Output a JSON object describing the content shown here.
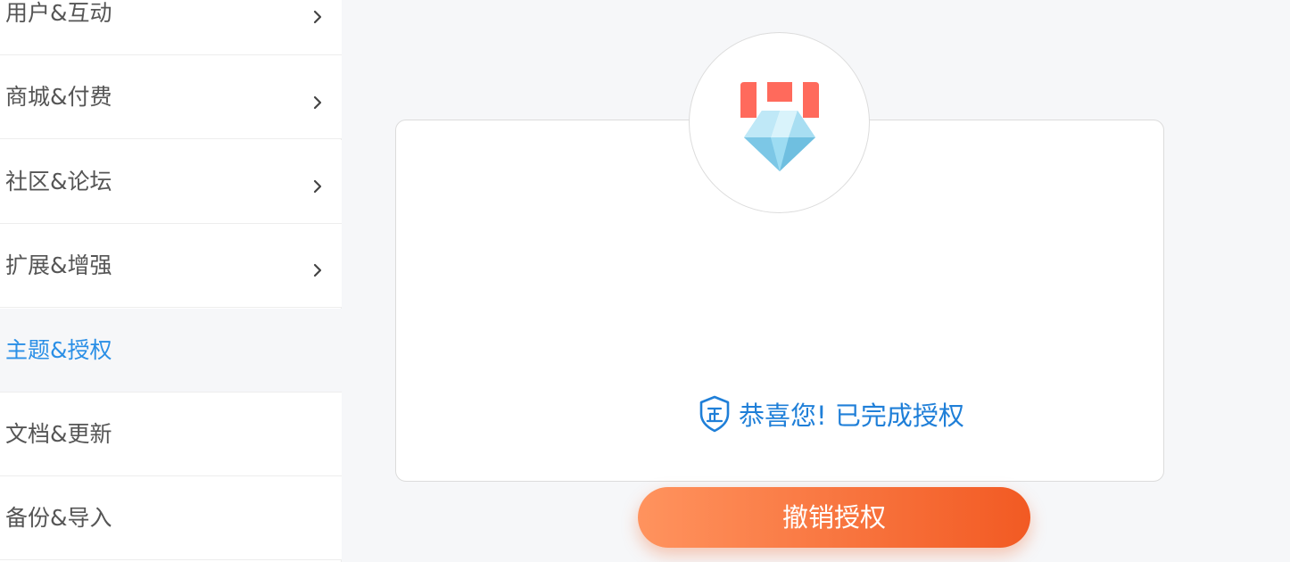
{
  "sidebar": {
    "items": [
      {
        "label": "用户&互动",
        "has_arrow": true,
        "active": false
      },
      {
        "label": "商城&付费",
        "has_arrow": true,
        "active": false
      },
      {
        "label": "社区&论坛",
        "has_arrow": true,
        "active": false
      },
      {
        "label": "扩展&增强",
        "has_arrow": true,
        "active": false
      },
      {
        "label": "主题&授权",
        "has_arrow": false,
        "active": true
      },
      {
        "label": "文档&更新",
        "has_arrow": false,
        "active": false
      },
      {
        "label": "备份&导入",
        "has_arrow": false,
        "active": false
      }
    ]
  },
  "license_card": {
    "status_icon": "shield-verified-icon",
    "status_text": "恭喜您! 已完成授权",
    "revoke_button_label": "撤销授权",
    "medal_icon": "diamond-medal-icon"
  },
  "colors": {
    "accent_blue": "#1f7fd8",
    "active_menu_text": "#2a8fe6",
    "button_gradient_start": "#ff935e",
    "button_gradient_end": "#f25a23",
    "ribbon_red": "#ff6a5c",
    "diamond_blue": "#8fd6f0"
  }
}
